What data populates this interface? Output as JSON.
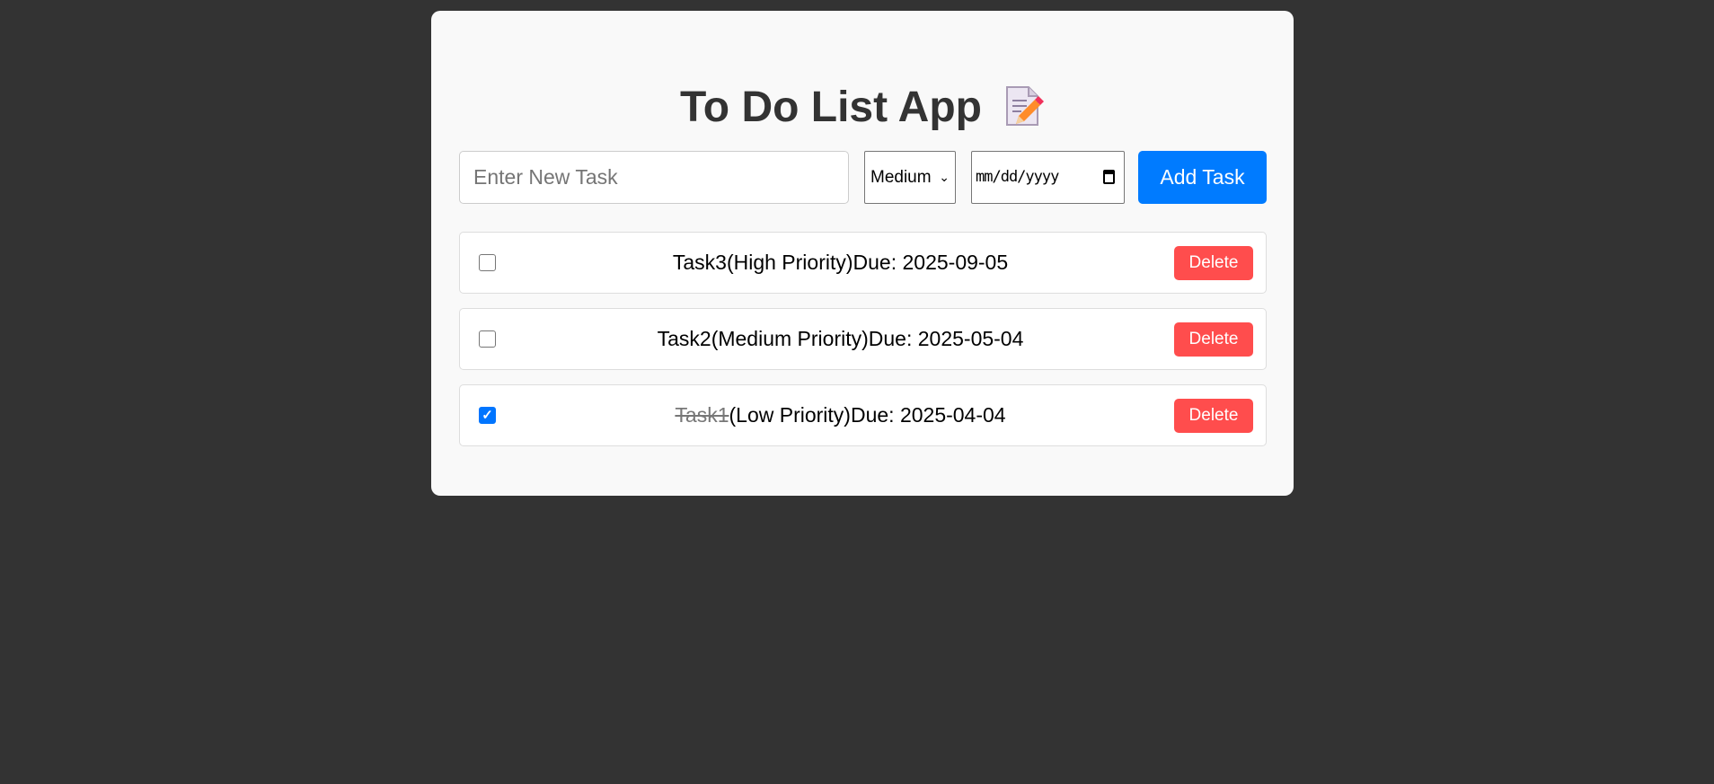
{
  "header": {
    "title": "To Do List App",
    "emoji": "memo-icon"
  },
  "form": {
    "task_placeholder": "Enter New Task",
    "priority_selected": "Medium",
    "date_placeholder": "mm/dd/yyyy",
    "add_label": "Add Task"
  },
  "tasks": [
    {
      "name": "Task3",
      "priority": "(High Priority)",
      "due": "Due: 2025-09-05",
      "completed": false,
      "delete_label": "Delete"
    },
    {
      "name": "Task2",
      "priority": "(Medium Priority)",
      "due": "Due: 2025-05-04",
      "completed": false,
      "delete_label": "Delete"
    },
    {
      "name": "Task1",
      "priority": "(Low Priority)",
      "due": "Due: 2025-04-04",
      "completed": true,
      "delete_label": "Delete"
    }
  ],
  "colors": {
    "background": "#333333",
    "card": "#f9f9f9",
    "accent": "#007bff",
    "danger": "#ff4d4d"
  }
}
